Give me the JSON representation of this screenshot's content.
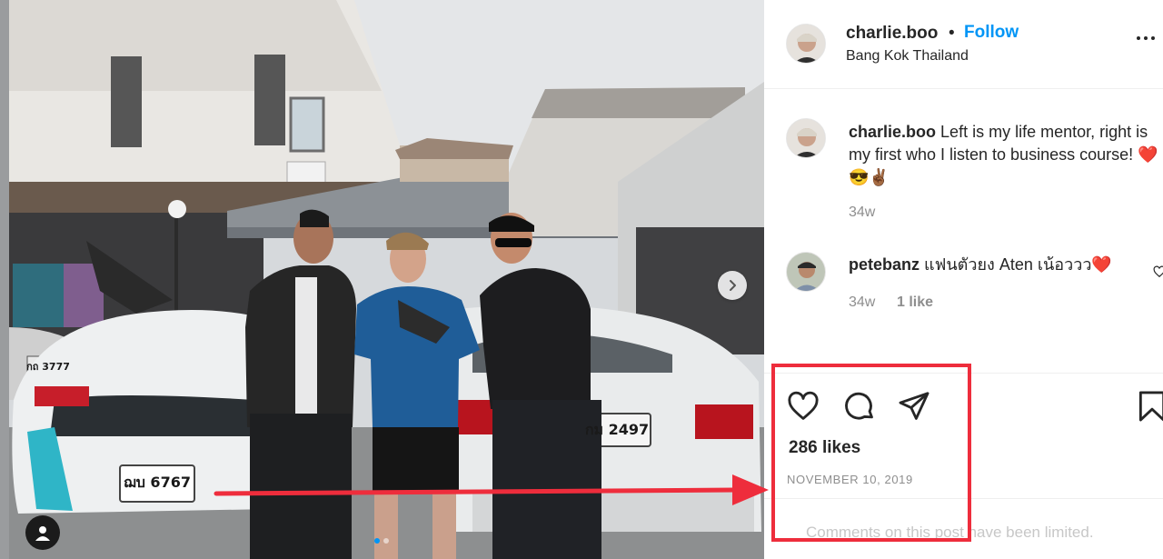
{
  "post": {
    "username": "charlie.boo",
    "separator": "•",
    "follow_label": "Follow",
    "location": "Bang Kok Thailand",
    "more_icon": "more-horizontal-icon"
  },
  "comments": [
    {
      "username": "charlie.boo",
      "text": "Left is my life mentor, right is my first who I listen to business course! ❤️😎✌🏾",
      "time": "34w"
    },
    {
      "username": "petebanz",
      "text": "แฟนตัวยง Aten เน้อววว❤️",
      "time": "34w",
      "likes": "1 like"
    }
  ],
  "actions": {
    "like_icon": "heart-icon",
    "comment_icon": "comment-icon",
    "share_icon": "paper-plane-icon",
    "save_icon": "bookmark-icon"
  },
  "likes_count": "286 likes",
  "post_date": "NOVEMBER 10, 2019",
  "comments_limited_text": "Comments on this post have been limited.",
  "photo": {
    "plate_left": "ฌบ 6767",
    "plate_right": "กม 2497",
    "plate_small": "กถ 3777",
    "carousel_dots": 2,
    "active_dot": 0
  },
  "colors": {
    "link_blue": "#0095f6",
    "annotation_red": "#ee2d3c",
    "muted_text": "#8e8e8e"
  }
}
